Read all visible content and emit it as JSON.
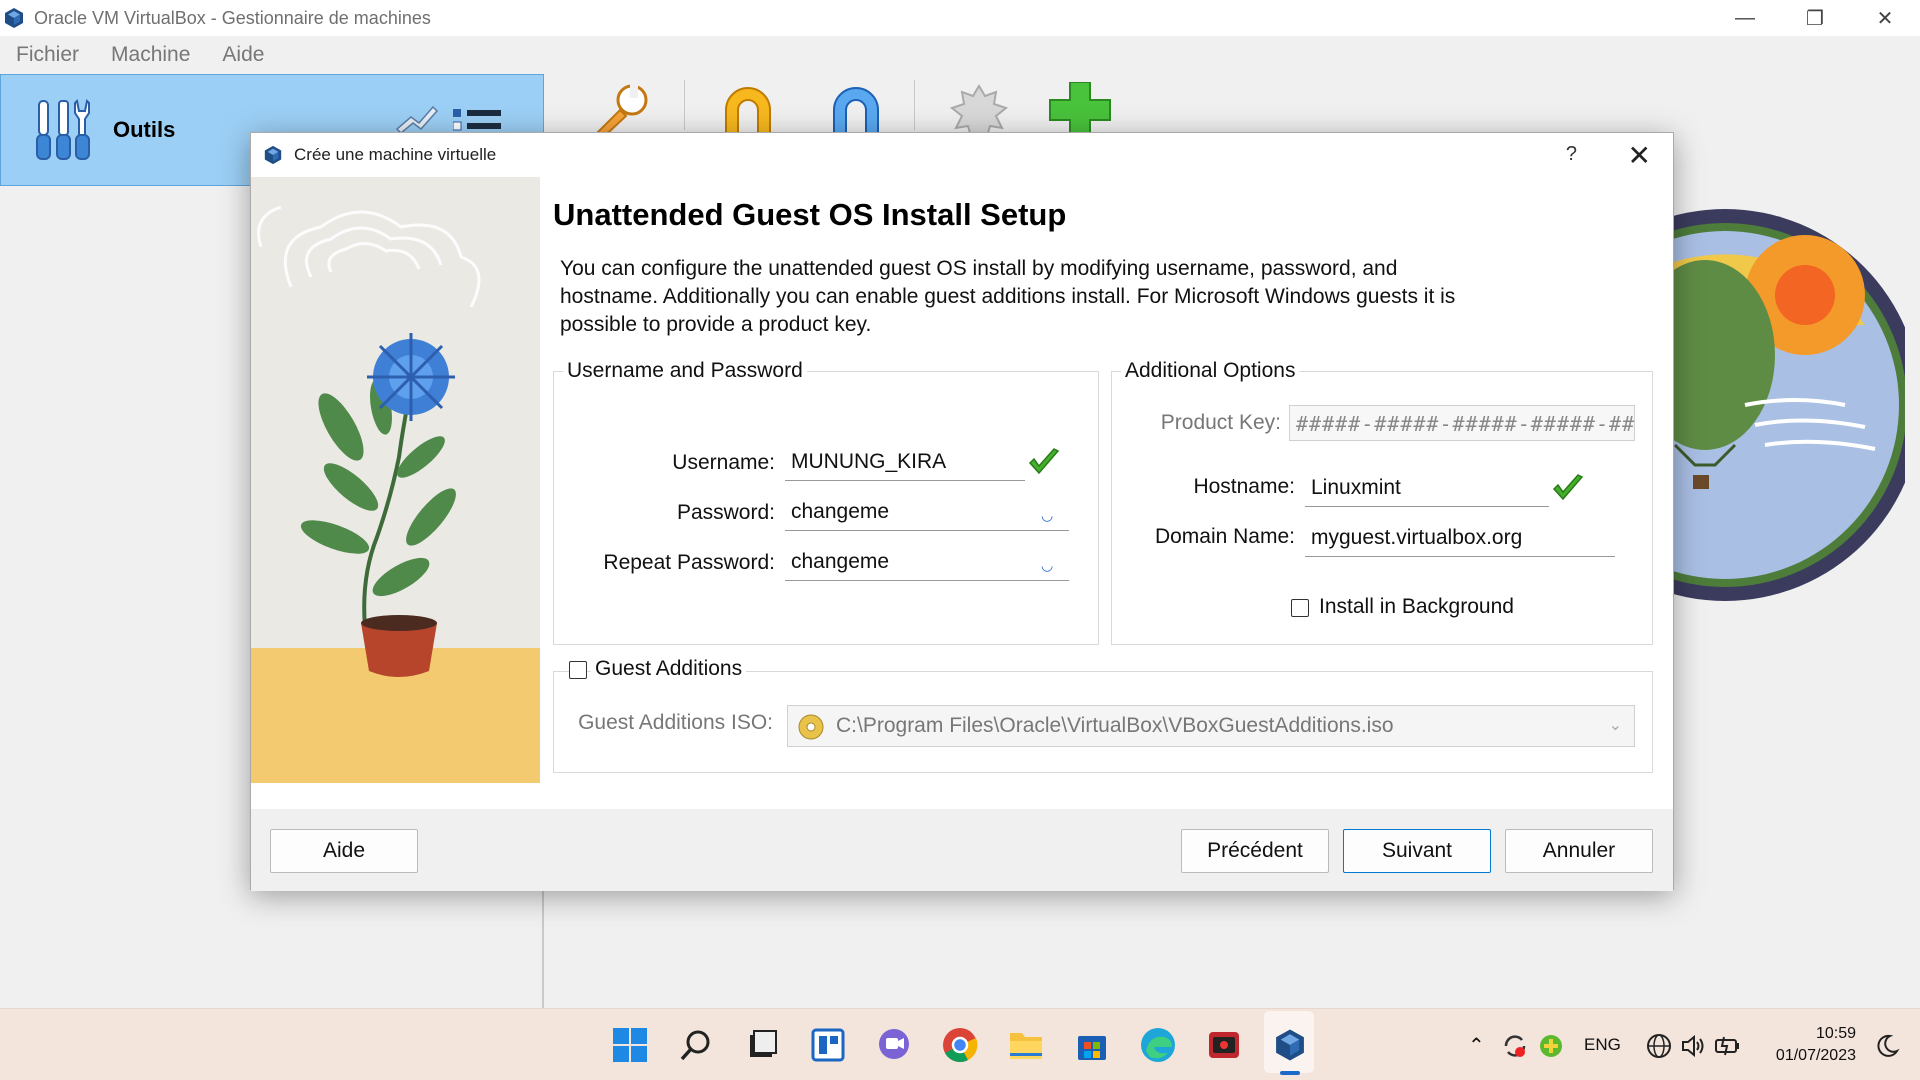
{
  "window": {
    "title": "Oracle VM VirtualBox - Gestionnaire de machines",
    "controls": {
      "minimize": "—",
      "restore": "❐",
      "close": "✕"
    }
  },
  "menu": {
    "items": [
      "Fichier",
      "Machine",
      "Aide"
    ]
  },
  "tools_panel": {
    "label": "Outils"
  },
  "dialog": {
    "title": "Crée une machine virtuelle",
    "help": "?",
    "close": "✕",
    "heading": "Unattended Guest OS Install Setup",
    "description": "You can configure the unattended guest OS install by modifying username, password, and hostname. Additionally you can enable guest additions install. For Microsoft Windows guests it is possible to provide a product key.",
    "user_group": {
      "title": "Username and Password",
      "username_label": "Username:",
      "username_value": "MUNUNG_KIRA",
      "password_label": "Password:",
      "password_value": "changeme",
      "repeat_label": "Repeat Password:",
      "repeat_value": "changeme"
    },
    "options_group": {
      "title": "Additional Options",
      "product_key_label": "Product Key:",
      "product_key_placeholder": "#####-#####-#####-#####-#####",
      "hostname_label": "Hostname:",
      "hostname_value": "Linuxmint",
      "domain_label": "Domain Name:",
      "domain_value": "myguest.virtualbox.org",
      "install_bg_label": "Install in Background",
      "install_bg_checked": false
    },
    "guest_additions": {
      "label": "Guest Additions",
      "checked": false,
      "iso_label": "Guest Additions ISO:",
      "iso_value": "C:\\Program Files\\Oracle\\VirtualBox\\VBoxGuestAdditions.iso"
    },
    "buttons": {
      "help": "Aide",
      "back": "Précédent",
      "next": "Suivant",
      "cancel": "Annuler"
    }
  },
  "taskbar": {
    "apps": [
      "windows-start",
      "search",
      "task-view",
      "widgets",
      "chat",
      "chrome",
      "file-explorer",
      "microsoft-store",
      "edge",
      "screen-recorder",
      "virtualbox"
    ],
    "language": "ENG",
    "time": "10:59",
    "date": "01/07/2023"
  }
}
